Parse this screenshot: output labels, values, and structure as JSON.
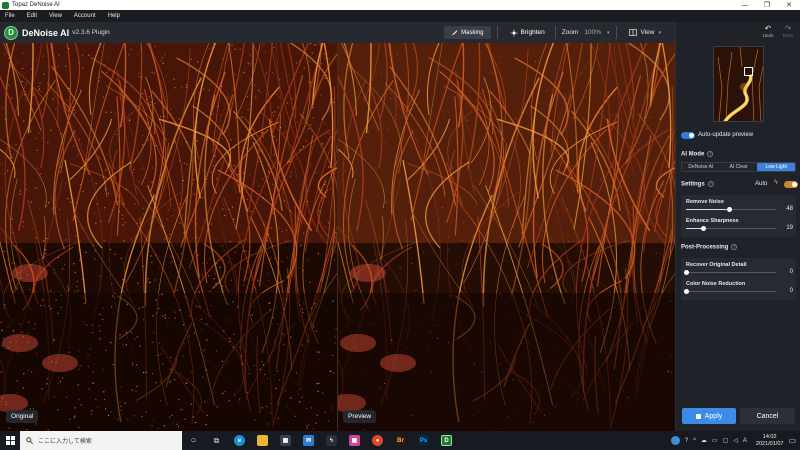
{
  "os_window": {
    "title": "Topaz DeNoise AI",
    "controls": [
      "—",
      "❐",
      "✕"
    ]
  },
  "menu": [
    "File",
    "Edit",
    "View",
    "Account",
    "Help"
  ],
  "header": {
    "logo_letter": "D",
    "app_name": "DeNoise AI",
    "version": "v2.3.6 Plugin",
    "masking_label": "Masking",
    "brighten_label": "Brighten",
    "zoom_label": "Zoom",
    "zoom_value": "100%",
    "view_label": "View"
  },
  "preview": {
    "left_label": "Original",
    "right_label": "Preview"
  },
  "sidebar": {
    "undo_label": "Undo",
    "redo_label": "Redo",
    "auto_update_label": "Auto-update preview",
    "auto_update_on": true,
    "ai_mode_label": "AI Mode",
    "modes": [
      "DeNoise AI",
      "AI Clear",
      "Low Light"
    ],
    "active_mode": "Low Light",
    "settings_label": "Settings",
    "auto_label": "Auto",
    "auto_on": true,
    "sliders": [
      {
        "label": "Remove Noise",
        "value": "48",
        "fraction": 0.48
      },
      {
        "label": "Enhance Sharpness",
        "value": "19",
        "fraction": 0.19
      }
    ],
    "post_processing_label": "Post-Processing",
    "post_sliders": [
      {
        "label": "Recover Original Detail",
        "value": "0",
        "fraction": 0.0
      },
      {
        "label": "Color Noise Reduction",
        "value": "0",
        "fraction": 0.0
      }
    ],
    "apply_label": "Apply",
    "cancel_label": "Cancel"
  },
  "taskbar": {
    "search_placeholder": "ここに入力して検索",
    "apps": [
      "task-view",
      "edge",
      "file-explorer",
      "store",
      "mail",
      "ai-app",
      "chrome",
      "bridge",
      "photoshop",
      "denoise"
    ],
    "tray_lang": "A",
    "time": "14:02",
    "date": "2021/01/07"
  },
  "colors": {
    "accent": "#3c8ce7",
    "auto_toggle": "#c88a2a",
    "photo_warm": "#d0501c"
  }
}
